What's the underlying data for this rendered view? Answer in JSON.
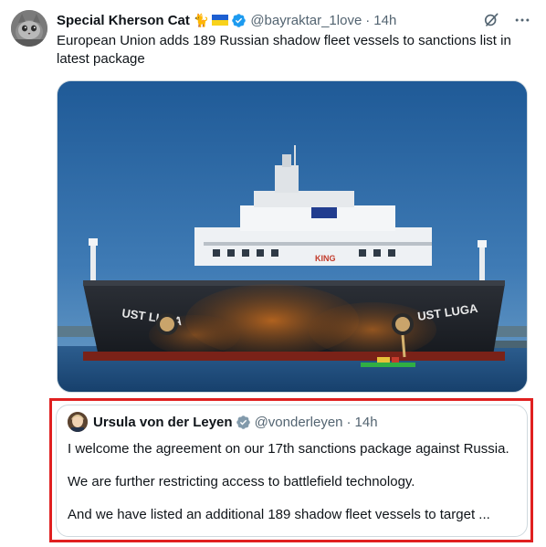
{
  "tweet": {
    "author": {
      "display_name": "Special Kherson Cat",
      "emoji": "🐈",
      "flag": "ukraine-flag",
      "handle": "@bayraktar_1love",
      "separator": "·",
      "time": "14h",
      "verified": true
    },
    "text": "European Union adds 189 Russian shadow fleet vessels to sanctions list in latest package",
    "actions": [
      "grok-icon",
      "more-icon"
    ],
    "media": {
      "description_icon": "ship-photo",
      "hull_text_left": "UST LUGA",
      "hull_text_right": "UST LUGA",
      "bridge_text": "KING"
    },
    "quote": {
      "author": {
        "display_name": "Ursula von der Leyen",
        "handle": "@vonderleyen",
        "separator": "·",
        "time": "14h",
        "verified": true
      },
      "paragraphs": [
        "I welcome the agreement on our 17th sanctions package against Russia.",
        "We are further restricting access to battlefield technology.",
        "And we have listed an additional 189 shadow fleet vessels to target ..."
      ]
    }
  },
  "colors": {
    "text_primary": "#0f1419",
    "text_secondary": "#536471",
    "verified_blue": "#1d9bf0",
    "verified_gray": "#829aab",
    "highlight_red": "#e02020",
    "border": "#cfd9de"
  }
}
